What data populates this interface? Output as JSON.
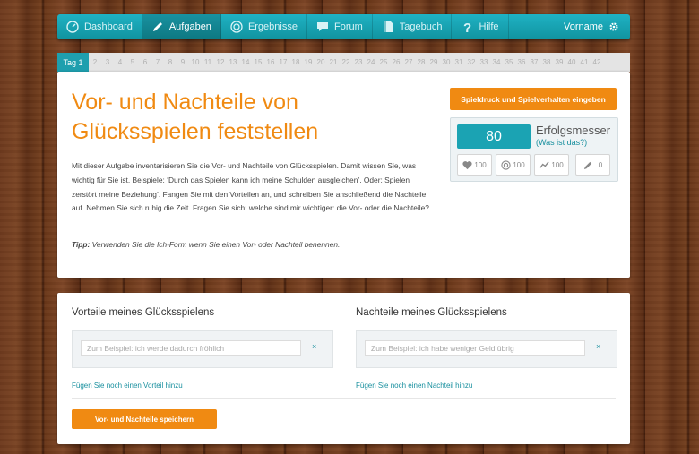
{
  "nav": {
    "items": [
      {
        "label": "Dashboard",
        "icon": "dashboard-icon"
      },
      {
        "label": "Aufgaben",
        "icon": "pencil-icon"
      },
      {
        "label": "Ergebnisse",
        "icon": "target-icon"
      },
      {
        "label": "Forum",
        "icon": "chat-icon"
      },
      {
        "label": "Tagebuch",
        "icon": "book-icon"
      },
      {
        "label": "Hilfe",
        "icon": "question-icon"
      }
    ],
    "user_label": "Vorname",
    "active": "Aufgaben"
  },
  "days": {
    "active_label": "Tag 1",
    "others": [
      "2",
      "3",
      "4",
      "5",
      "6",
      "7",
      "8",
      "9",
      "10",
      "11",
      "12",
      "13",
      "14",
      "15",
      "16",
      "17",
      "18",
      "19",
      "20",
      "21",
      "22",
      "23",
      "24",
      "25",
      "26",
      "27",
      "28",
      "29",
      "30",
      "31",
      "32",
      "33",
      "34",
      "35",
      "36",
      "37",
      "38",
      "39",
      "40",
      "41",
      "42"
    ]
  },
  "task": {
    "title": "Vor- und Nachteile von Glücksspielen feststellen",
    "description": "Mit dieser Aufgabe inventarisieren Sie die Vor- und Nachteile von Glücksspielen. Damit wissen Sie, was wichtig für Sie ist. Beispiele: ‘Durch das Spielen kann ich meine Schulden ausgleichen’. Oder: Spielen zerstört meine Beziehung’. Fangen Sie mit den Vorteilen an, und schreiben Sie anschließend die Nachteile auf. Nehmen Sie sich ruhig die Zeit. Fragen Sie sich: welche sind mir wichtiger: die Vor- oder die Nachteile?",
    "tip_label": "Tipp:",
    "tip_text": " Verwenden Sie die Ich-Form wenn Sie einen Vor- oder Nachteil benennen."
  },
  "actions": {
    "game_pressure_button": "Spieldruck und Spielverhalten eingeben",
    "save_button": "Vor- und Nachteile speichern"
  },
  "meter": {
    "score": "80",
    "title": "Erfolgsmesser",
    "link": "(Was ist das?)",
    "stats": [
      {
        "icon": "heart-icon",
        "value": "100"
      },
      {
        "icon": "target-icon",
        "value": "100"
      },
      {
        "icon": "trend-icon",
        "value": "100"
      },
      {
        "icon": "pencil-icon",
        "value": "0"
      }
    ]
  },
  "pros": {
    "heading": "Vorteile meines Glücksspielens",
    "placeholder": "Zum Beispiel: ich werde dadurch fröhlich",
    "clear": "×",
    "add_link": "Fügen Sie noch einen Vorteil hinzu"
  },
  "cons": {
    "heading": "Nachteile meines Glücksspielens",
    "placeholder": "Zum Beispiel: ich habe weniger Geld übrig",
    "clear": "×",
    "add_link": "Fügen Sie noch einen Nachteil hinzu"
  },
  "colors": {
    "accent": "#f08a12",
    "teal": "#1ba3b3",
    "link": "#178f9e"
  }
}
